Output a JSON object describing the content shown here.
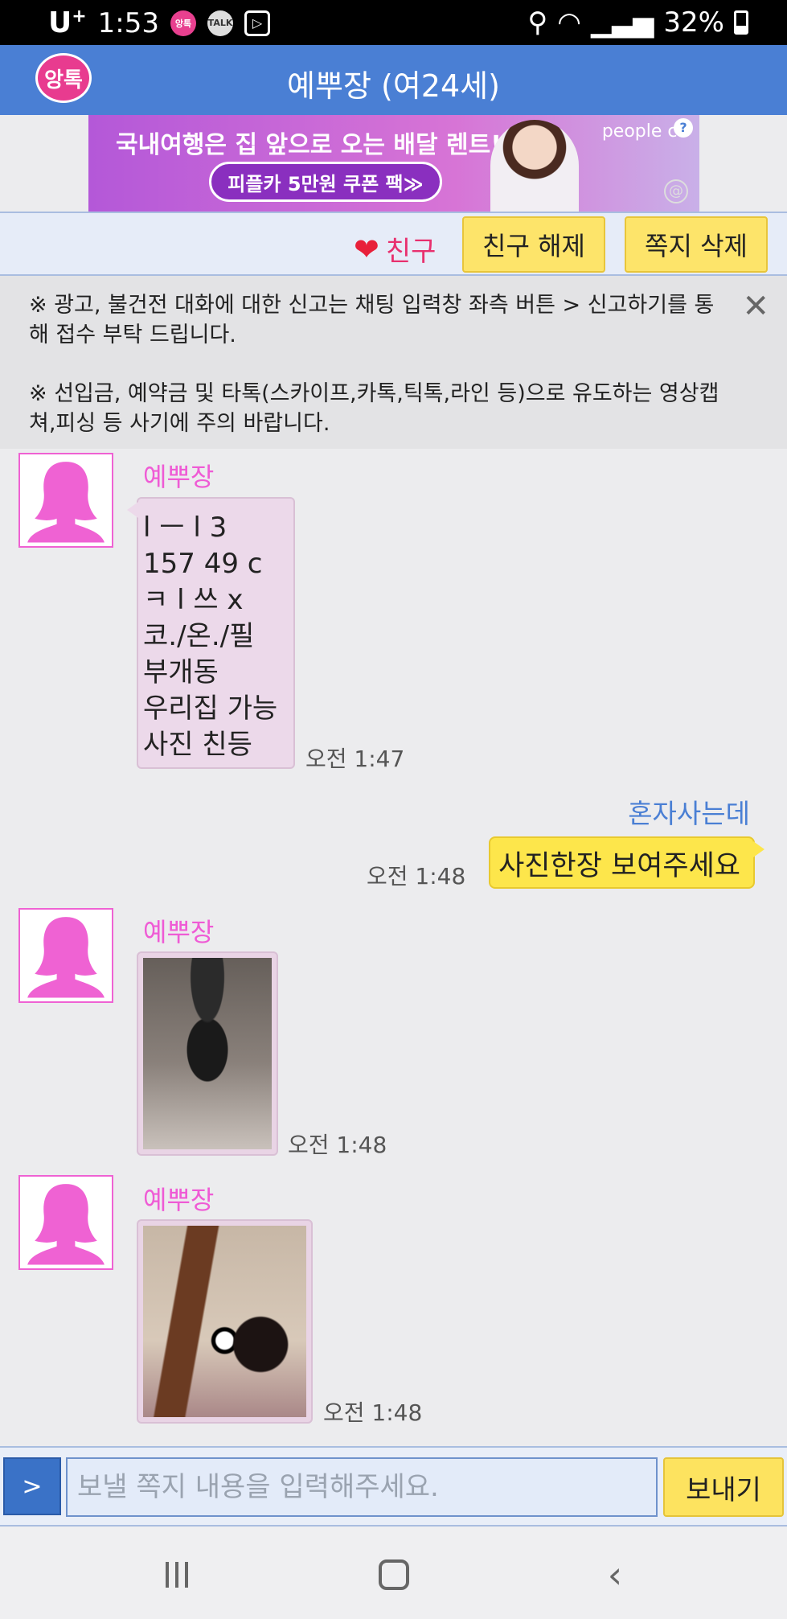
{
  "status_bar": {
    "carrier": "U",
    "carrier_plus": "+",
    "time": "1:53",
    "yangtok_badge": "앙톡",
    "talk_badge": "TALK",
    "battery": "32%"
  },
  "header": {
    "logo_text": "앙톡",
    "title": "예뿌장 (여24세)"
  },
  "ad": {
    "headline": "국내여행은 집 앞으로 오는 배달 렌트!",
    "coupon": "피플카 5만원 쿠폰 팩≫",
    "brand": "people ca",
    "info": "?",
    "mark": "@"
  },
  "actions": {
    "friend_label": "친구",
    "unfriend_label": "친구 해제",
    "delete_label": "쪽지 삭제"
  },
  "notice": {
    "line1": "※ 광고, 불건전 대화에 대한 신고는 채팅 입력창 좌측 버튼 > 신고하기를 통해 접수 부탁 드립니다.",
    "line2": "※ 선입금, 예약금 및 타톡(스카이프,카톡,틱톡,라인 등)으로 유도하는 영상캡쳐,피싱 등 사기에 주의 바랍니다.",
    "close": "✕"
  },
  "messages": [
    {
      "sender": "예뿌장",
      "text": "l ㅡ l 3\n157 49 c\nㅋ l 쓰 x\n코./온./필\n부개동\n우리집 가능\n사진 친등",
      "time": "오전 1:47"
    },
    {
      "sender": "혼자사는데",
      "text": "사진한장 보여주세요",
      "time": "오전 1:48"
    },
    {
      "sender": "예뿌장",
      "time": "오전 1:48"
    },
    {
      "sender": "예뿌장",
      "time": "오전 1:48"
    }
  ],
  "input": {
    "expand_label": ">",
    "placeholder": "보낼 쪽지 내용을 입력해주세요.",
    "send_label": "보내기"
  }
}
